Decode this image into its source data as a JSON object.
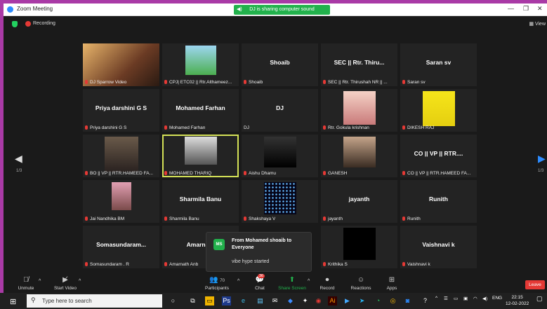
{
  "window": {
    "title": "Zoom Meeting",
    "share_banner": "DJ is sharing computer sound"
  },
  "status": {
    "recording": "Recording",
    "view": "View"
  },
  "nav": {
    "page_left": "1/3",
    "page_right": "1/3"
  },
  "tiles": [
    {
      "name": "DJ Sparrow Video",
      "big": "",
      "video": true,
      "thumb": "person-orange"
    },
    {
      "name": "CPJ| ETC02 || Rtr.Althameez...",
      "big": "",
      "video": true,
      "thumb": "person-green"
    },
    {
      "name": "Shoaib",
      "big": "Shoaib",
      "video": false
    },
    {
      "name": "SEC || Rtr. Thirushah NR || ...",
      "big": "SEC || Rtr. Thiru...",
      "video": false
    },
    {
      "name": "Saran sv",
      "big": "Saran sv",
      "video": false
    },
    {
      "name": "Priya darshini G S",
      "big": "Priya darshini G S",
      "video": false
    },
    {
      "name": "Mohamed Farhan",
      "big": "Mohamed Farhan",
      "video": false
    },
    {
      "name": "DJ",
      "big": "DJ",
      "video": false,
      "nomic": true
    },
    {
      "name": "Rtr. Gokula krishnan",
      "big": "",
      "video": true,
      "thumb": "person-pink"
    },
    {
      "name": "DIKESH RAJ",
      "big": "",
      "video": true,
      "thumb": "person-yellow"
    },
    {
      "name": "BO || VP || RTR.HAMEED FA...",
      "big": "",
      "video": true,
      "thumb": "person-dark"
    },
    {
      "name": "MOHAMED THARIQ",
      "big": "",
      "video": true,
      "thumb": "person-grey",
      "active": true
    },
    {
      "name": "Aishu Dhamu",
      "big": "",
      "video": true,
      "thumb": "quote-image"
    },
    {
      "name": "GANESH",
      "big": "",
      "video": true,
      "thumb": "person-brown"
    },
    {
      "name": "CO || VP || RTR.HAMEED FA...",
      "big": "CO || VP || RTR....",
      "video": false
    },
    {
      "name": "Jai Nandhika BM",
      "big": "",
      "video": true,
      "thumb": "person-pink2"
    },
    {
      "name": "Sharmila Banu",
      "big": "Sharmila Banu",
      "video": false
    },
    {
      "name": "Shakshaya V",
      "big": "",
      "video": true,
      "thumb": "stars"
    },
    {
      "name": "jayanth",
      "big": "jayanth",
      "video": false
    },
    {
      "name": "Runith",
      "big": "Runith",
      "video": false
    },
    {
      "name": "Somasundaram . R",
      "big": "Somasundaram...",
      "video": false
    },
    {
      "name": "Amarnath Anb",
      "big": "Amarnath",
      "video": false
    },
    {
      "name": "",
      "big": "",
      "video": false,
      "hidden": true
    },
    {
      "name": "Krithika S",
      "big": "",
      "video": true,
      "thumb": "black"
    },
    {
      "name": "Vaishnavi k",
      "big": "Vaishnavi k",
      "video": false
    }
  ],
  "chat_popup": {
    "avatar": "MS",
    "from": "From Mohamed shoaib to Everyone",
    "message": "vibe  hype started"
  },
  "toolbar": {
    "unmute": "Unmute",
    "start_video": "Start Video",
    "participants": "Participants",
    "participants_count": "70",
    "chat": "Chat",
    "chat_badge": "36",
    "share_screen": "Share Screen",
    "record": "Record",
    "reactions": "Reactions",
    "apps": "Apps",
    "leave": "Leave"
  },
  "taskbar": {
    "search_placeholder": "Type here to search",
    "lang": "ENG",
    "time": "22:15",
    "date": "12-02-2022"
  }
}
